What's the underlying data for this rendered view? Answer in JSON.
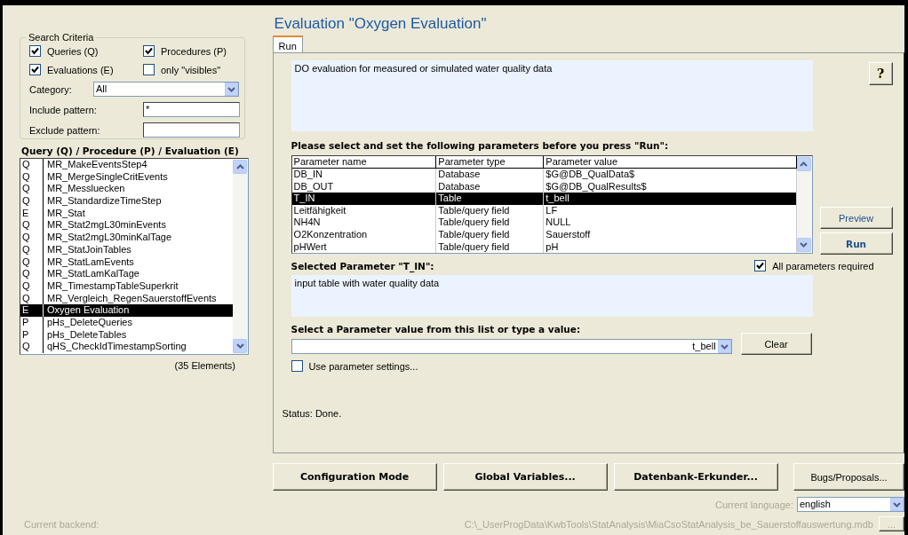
{
  "window": {
    "title": "Evaluation \"Oxygen Evaluation\""
  },
  "search_criteria": {
    "legend": "Search Criteria",
    "checkboxes": [
      {
        "label": "Queries (Q)",
        "checked": true
      },
      {
        "label": "Procedures (P)",
        "checked": true
      },
      {
        "label": "Evaluations (E)",
        "checked": true
      },
      {
        "label": "only \"visibles\"",
        "checked": false
      }
    ],
    "category": {
      "label": "Category:",
      "value": "All"
    },
    "include_pattern": {
      "label": "Include pattern:",
      "value": "*"
    },
    "exclude_pattern": {
      "label": "Exclude pattern:"
    }
  },
  "object_list": {
    "heading": "Query (Q) / Procedure (P) / Evaluation (E)",
    "items": [
      {
        "type": "Q",
        "name": "MR_MakeEventsStep4",
        "selected": false
      },
      {
        "type": "Q",
        "name": "MR_MergeSingleCritEvents",
        "selected": false
      },
      {
        "type": "Q",
        "name": "MR_Messluecken",
        "selected": false
      },
      {
        "type": "Q",
        "name": "MR_StandardizeTimeStep",
        "selected": false
      },
      {
        "type": "E",
        "name": "MR_Stat",
        "selected": false
      },
      {
        "type": "Q",
        "name": "MR_Stat2mgL30minEvents",
        "selected": false
      },
      {
        "type": "Q",
        "name": "MR_Stat2mgL30minKalTage",
        "selected": false
      },
      {
        "type": "Q",
        "name": "MR_StatJoinTables",
        "selected": false
      },
      {
        "type": "Q",
        "name": "MR_StatLamEvents",
        "selected": false
      },
      {
        "type": "Q",
        "name": "MR_StatLamKalTage",
        "selected": false
      },
      {
        "type": "Q",
        "name": "MR_TimestampTableSuperkrit",
        "selected": false
      },
      {
        "type": "Q",
        "name": "MR_Vergleich_RegenSauerstoffEvents",
        "selected": false
      },
      {
        "type": "E",
        "name": "Oxygen Evaluation",
        "selected": true
      },
      {
        "type": "P",
        "name": "pHs_DeleteQueries",
        "selected": false
      },
      {
        "type": "P",
        "name": "pHs_DeleteTables",
        "selected": false
      },
      {
        "type": "Q",
        "name": "qHS_CheckIdTimestampSorting",
        "selected": false
      }
    ],
    "count": "(35 Elements)"
  },
  "tabs": [
    {
      "label": "Run",
      "selected": true
    }
  ],
  "description": "DO evaluation for measured or simulated water quality data",
  "help_button": "?",
  "parameters": {
    "heading": "Please select and set the following parameters before you press \"Run\":",
    "columns": [
      "Parameter name",
      "Parameter type",
      "Parameter value"
    ],
    "rows": [
      {
        "name": "DB_IN",
        "type": "Database",
        "value": "$G@DB_QualData$",
        "selected": false
      },
      {
        "name": "DB_OUT",
        "type": "Database",
        "value": "$G@DB_QualResults$",
        "selected": false
      },
      {
        "name": "T_IN",
        "type": "Table",
        "value": "t_bell",
        "selected": true
      },
      {
        "name": "Leitfähigkeit",
        "type": "Table/query field",
        "value": "LF",
        "selected": false
      },
      {
        "name": "NH4N",
        "type": "Table/query field",
        "value": "NULL",
        "selected": false
      },
      {
        "name": "O2Konzentration",
        "type": "Table/query field",
        "value": "Sauerstoff",
        "selected": false
      },
      {
        "name": "pHWert",
        "type": "Table/query field",
        "value": "pH",
        "selected": false
      }
    ]
  },
  "preview_button": "Preview",
  "run_button": "Run",
  "selected_parameter": {
    "heading": "Selected Parameter \"T_IN\":",
    "description": "input table with water quality data"
  },
  "all_required": {
    "label": "All parameters required",
    "checked": true
  },
  "value_picker": {
    "heading": "Select a Parameter value from this list or type a value:",
    "value": "t_bell",
    "clear_button": "Clear"
  },
  "use_settings": {
    "label": "Use parameter settings...",
    "checked": false
  },
  "status": "Status: Done.",
  "bottom_buttons": [
    {
      "label": "Configuration Mode",
      "kind": "bold"
    },
    {
      "label": "Global Variables...",
      "kind": "bold"
    },
    {
      "label": "Datenbank-Erkunder...",
      "kind": "bold"
    },
    {
      "label": "Bugs/Proposals...",
      "kind": "normal"
    }
  ],
  "language": {
    "label": "Current language:",
    "value": "english"
  },
  "backend": {
    "label": "Current backend:",
    "path": "C:\\_UserProgData\\KwbTools\\StatAnalysis\\MiaCsoStatAnalysis_be_Sauerstoffauswertung.mdb",
    "browse_button": "..."
  }
}
